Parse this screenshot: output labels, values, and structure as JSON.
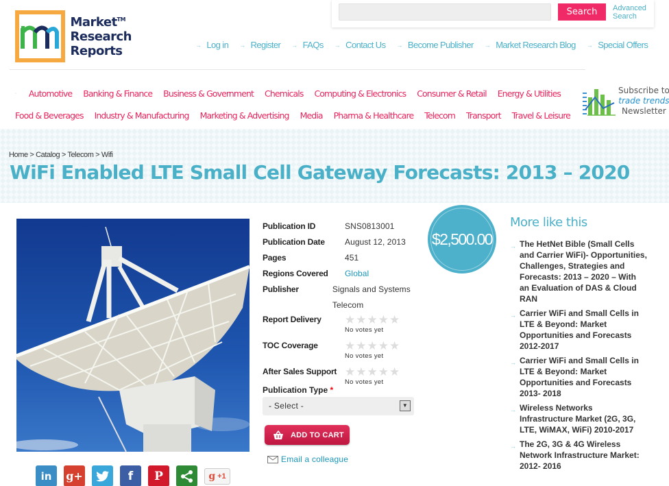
{
  "logo": {
    "line1": "Market",
    "line2": "Research",
    "line3": "Reports",
    "tm": "TM"
  },
  "search": {
    "placeholder": "",
    "value": "",
    "button_label": "Search",
    "advanced_label_1": "Advanced",
    "advanced_label_2": "Search"
  },
  "top_links": [
    "Log in",
    "Register",
    "FAQs",
    "Contact Us",
    "Become Publisher",
    "Market Research Blog",
    "Special Offers"
  ],
  "categories": {
    "row1": [
      "Automotive",
      "Banking & Finance",
      "Business & Government",
      "Chemicals",
      "Computing & Electronics",
      "Consumer & Retail",
      "Energy & Utilities"
    ],
    "row2": [
      "Food & Beverages",
      "Industry & Manufacturing",
      "Marketing & Advertising",
      "Media",
      "Pharma & Healthcare",
      "Telecom",
      "Transport",
      "Travel & Leisure"
    ]
  },
  "newsletter": {
    "line1": "Subscribe to",
    "line2": "trade trends",
    "line3": "Newsletter"
  },
  "breadcrumb": [
    "Home",
    "Catalog",
    "Telecom",
    "Wifi"
  ],
  "breadcrumb_sep": " > ",
  "title": "WiFi Enabled LTE Small Cell Gateway Forecasts: 2013 – 2020",
  "price": "$2,500.00",
  "details": [
    {
      "label": "Publication ID",
      "value": "SNS0813001"
    },
    {
      "label": "Publication Date",
      "value": "August 12, 2013"
    },
    {
      "label": "Pages",
      "value": "451"
    },
    {
      "label": "Regions Covered",
      "value": "Global"
    },
    {
      "label": "Publisher",
      "value": "Signals and Systems Telecom"
    }
  ],
  "ratings": [
    {
      "label": "Report Delivery",
      "stars": 0,
      "max": 5,
      "note": "No votes yet"
    },
    {
      "label": "TOC Coverage",
      "stars": 0,
      "max": 5,
      "note": "No votes yet"
    },
    {
      "label": "After Sales Support",
      "stars": 0,
      "max": 5,
      "note": "No votes yet"
    }
  ],
  "publication_type": {
    "label": "Publication Type",
    "required_mark": "*",
    "selected": "- Select -"
  },
  "cart_label": "ADD TO CART",
  "email_label": "Email a colleague",
  "social": {
    "linkedin": "in",
    "googleplus": "g+",
    "facebook": "f",
    "pinterest": "P",
    "gplus_one": "+1"
  },
  "more_like_this": {
    "title": "More like this",
    "items": [
      "The HetNet Bible (Small Cells and Carrier WiFi)- Opportunities, Challenges, Strategies and Forecasts: 2013 – 2020 – With an Evaluation of DAS & Cloud RAN",
      "Carrier WiFi and Small Cells in LTE & Beyond: Market Opportunities and Forecasts 2012-2017",
      "Carrier WiFi and Small Cells in LTE & Beyond: Market Opportunities and Forecasts 2013- 2018",
      "Wireless Networks Infrastructure Market (2G, 3G, LTE, WiMAX, WiFi) 2010-2017",
      "The 2G, 3G & 4G Wireless Network Infrastructure Market: 2012- 2016"
    ]
  },
  "colors": {
    "accent_teal": "#4ab0c8",
    "accent_pink": "#e8245e",
    "search_button": "#ef2a67",
    "cart_button": "#d0214f",
    "price_badge": "#4db1cb",
    "logo_orange": "#f7a941"
  }
}
